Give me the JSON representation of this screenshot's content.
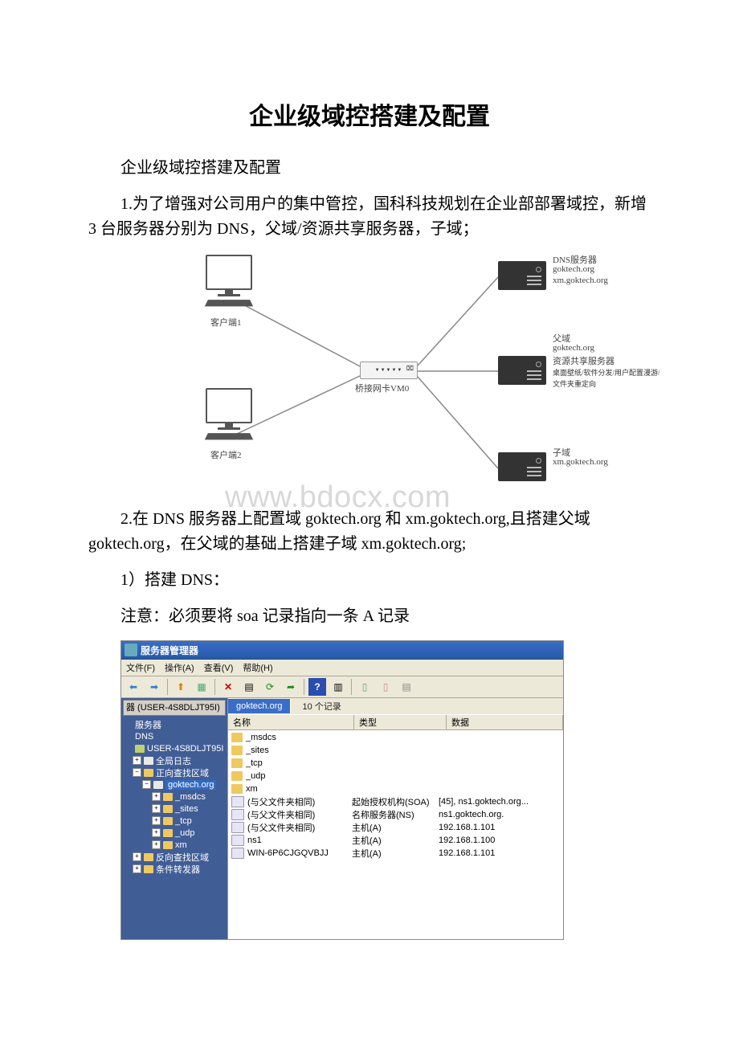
{
  "title": "企业级域控搭建及配置",
  "subtitle": "企业级域控搭建及配置",
  "para1": "1.为了增强对公司用户的集中管控，国科科技规划在企业部部署域控，新增 3 台服务器分别为 DNS，父域/资源共享服务器，子域；",
  "para2": "2.在 DNS 服务器上配置域 goktech.org 和 xm.goktech.org,且搭建父域 goktech.org，在父域的基础上搭建子域 xm.goktech.org;",
  "para3": "1）搭建 DNS：",
  "para4": "注意：必须要将 soa 记录指向一条 A 记录",
  "diagram": {
    "watermark": "www.bdocx.com",
    "client1": "客户端1",
    "client2": "客户端2",
    "switch_label": "桥接网卡VM0",
    "dns_l1": "DNS服务器",
    "dns_l2": "goktech.org",
    "dns_l3": "xm.goktech.org",
    "parent_l1": "父域",
    "parent_l2": "goktech.org",
    "parent_l3": "资源共享服务器",
    "parent_l4": "桌面壁纸/软件分发/用户配置漫游/",
    "parent_l5": "文件夹重定向",
    "child_l1": "子域",
    "child_l2": "xm.goktech.org"
  },
  "mmc": {
    "title": "服务器管理器",
    "menu": {
      "file": "文件(F)",
      "action": "操作(A)",
      "view": "查看(V)",
      "help": "帮助(H)"
    },
    "tree_header": "器  (USER-4S8DLJT95I)",
    "tree": {
      "n1": "服务器",
      "n2": "DNS",
      "n3": "USER-4S8DLJT95I",
      "n4": "全局日志",
      "n5": "正向查找区域",
      "n6": "goktech.org",
      "n7": "_msdcs",
      "n8": "_sites",
      "n9": "_tcp",
      "n10": "_udp",
      "n11": "xm",
      "n12": "反向查找区域",
      "n13": "条件转发器"
    },
    "tab": "goktech.org",
    "record_count": "10 个记录",
    "cols": {
      "name": "名称",
      "type": "类型",
      "data": "数据"
    },
    "rows": [
      {
        "icon": "folder",
        "name": "_msdcs",
        "type": "",
        "data": ""
      },
      {
        "icon": "folder",
        "name": "_sites",
        "type": "",
        "data": ""
      },
      {
        "icon": "folder",
        "name": "_tcp",
        "type": "",
        "data": ""
      },
      {
        "icon": "folder",
        "name": "_udp",
        "type": "",
        "data": ""
      },
      {
        "icon": "folder",
        "name": "xm",
        "type": "",
        "data": ""
      },
      {
        "icon": "rec",
        "name": "(与父文件夹相同)",
        "type": "起始授权机构(SOA)",
        "data": "[45], ns1.goktech.org..."
      },
      {
        "icon": "rec",
        "name": "(与父文件夹相同)",
        "type": "名称服务器(NS)",
        "data": "ns1.goktech.org."
      },
      {
        "icon": "rec",
        "name": "(与父文件夹相同)",
        "type": "主机(A)",
        "data": "192.168.1.101"
      },
      {
        "icon": "rec",
        "name": "ns1",
        "type": "主机(A)",
        "data": "192.168.1.100"
      },
      {
        "icon": "rec",
        "name": "WIN-6P6CJGQVBJJ",
        "type": "主机(A)",
        "data": "192.168.1.101"
      }
    ]
  }
}
